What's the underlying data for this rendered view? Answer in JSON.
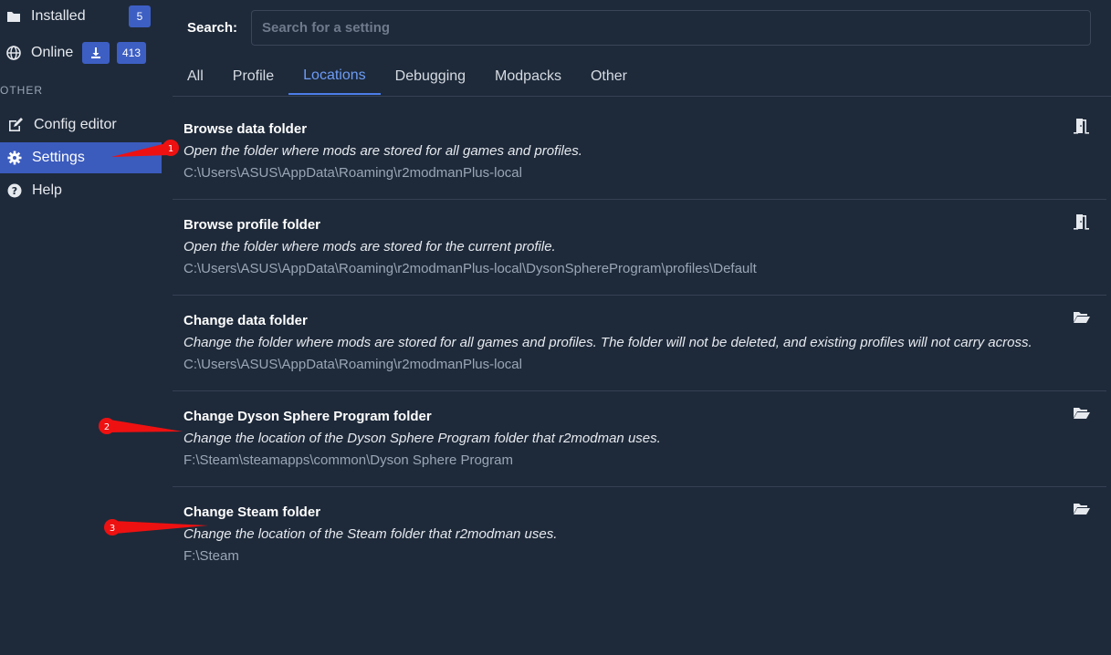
{
  "sidebar": {
    "installed": {
      "label": "Installed",
      "count": "5"
    },
    "online": {
      "label": "Online",
      "count": "413"
    },
    "other_heading": "OTHER",
    "items": [
      {
        "label": "Config editor",
        "icon": "pencil-icon"
      },
      {
        "label": "Settings",
        "icon": "gear-icon"
      },
      {
        "label": "Help",
        "icon": "question-icon"
      }
    ]
  },
  "search": {
    "label": "Search:",
    "placeholder": "Search for a setting",
    "value": ""
  },
  "tabs": [
    "All",
    "Profile",
    "Locations",
    "Debugging",
    "Modpacks",
    "Other"
  ],
  "active_tab": "Locations",
  "settings": [
    {
      "title": "Browse data folder",
      "desc": "Open the folder where mods are stored for all games and profiles.",
      "path": "C:\\Users\\ASUS\\AppData\\Roaming\\r2modmanPlus-local",
      "icon": "door-open-icon"
    },
    {
      "title": "Browse profile folder",
      "desc": "Open the folder where mods are stored for the current profile.",
      "path": "C:\\Users\\ASUS\\AppData\\Roaming\\r2modmanPlus-local\\DysonSphereProgram\\profiles\\Default",
      "icon": "door-open-icon"
    },
    {
      "title": "Change data folder",
      "desc": "Change the folder where mods are stored for all games and profiles. The folder will not be deleted, and existing profiles will not carry across.",
      "path": "C:\\Users\\ASUS\\AppData\\Roaming\\r2modmanPlus-local",
      "icon": "folder-open-icon"
    },
    {
      "title": "Change Dyson Sphere Program folder",
      "desc": "Change the location of the Dyson Sphere Program folder that r2modman uses.",
      "path": "F:\\Steam\\steamapps\\common\\Dyson Sphere Program",
      "icon": "folder-open-icon"
    },
    {
      "title": "Change Steam folder",
      "desc": "Change the location of the Steam folder that r2modman uses.",
      "path": "F:\\Steam",
      "icon": "folder-open-icon"
    }
  ],
  "annotations": [
    "1",
    "2",
    "3"
  ],
  "colors": {
    "background": "#1e2a3a",
    "accent": "#3b5bbd",
    "active_tab": "#6e9cf5",
    "annotation": "#ee1111"
  }
}
